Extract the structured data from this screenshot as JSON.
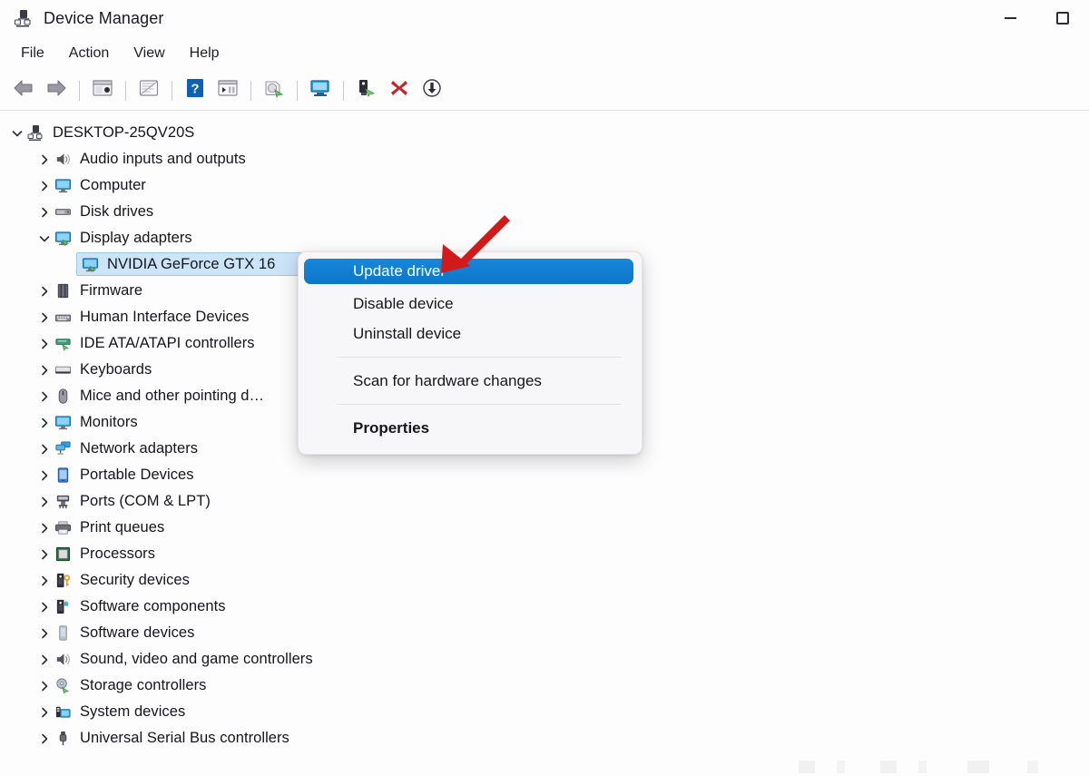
{
  "window": {
    "title": "Device Manager",
    "title_icon": "device-manager-icon",
    "minimize_label": "–",
    "maximize_label": "□"
  },
  "menubar": {
    "items": [
      {
        "label": "File"
      },
      {
        "label": "Action"
      },
      {
        "label": "View"
      },
      {
        "label": "Help"
      }
    ]
  },
  "toolbar": {
    "buttons": [
      {
        "name": "back-button",
        "icon": "back-arrow-icon"
      },
      {
        "name": "forward-button",
        "icon": "forward-arrow-icon"
      },
      {
        "name": "show-hide-console-tree-button",
        "icon": "console-tree-icon"
      },
      {
        "name": "properties-button",
        "icon": "properties-window-icon"
      },
      {
        "name": "help-button",
        "icon": "help-question-icon"
      },
      {
        "name": "show-hide-action-pane-button",
        "icon": "action-pane-icon"
      },
      {
        "name": "update-driver-software-button",
        "icon": "update-driver-icon"
      },
      {
        "name": "scan-for-hardware-changes-button",
        "icon": "monitor-scan-icon"
      },
      {
        "name": "update-device-driver-button",
        "icon": "driver-update-icon"
      },
      {
        "name": "uninstall-device-button",
        "icon": "red-x-icon"
      },
      {
        "name": "disable-device-button",
        "icon": "down-arrow-circle-icon"
      }
    ]
  },
  "tree": {
    "root": {
      "label": "DESKTOP-25QV20S",
      "icon": "computer-root-icon",
      "expanded": true
    },
    "items": [
      {
        "label": "Audio inputs and outputs",
        "icon": "speaker-icon",
        "expanded": false,
        "level": 1
      },
      {
        "label": "Computer",
        "icon": "monitor-icon",
        "expanded": false,
        "level": 1
      },
      {
        "label": "Disk drives",
        "icon": "disk-drive-icon",
        "expanded": false,
        "level": 1
      },
      {
        "label": "Display adapters",
        "icon": "display-adapter-icon",
        "expanded": true,
        "level": 1
      },
      {
        "label": "NVIDIA GeForce GTX 16",
        "icon": "display-adapter-icon",
        "expanded": null,
        "level": 2,
        "selected": true
      },
      {
        "label": "Firmware",
        "icon": "firmware-icon",
        "expanded": false,
        "level": 1
      },
      {
        "label": "Human Interface Devices",
        "icon": "hid-icon",
        "expanded": false,
        "level": 1
      },
      {
        "label": "IDE ATA/ATAPI controllers",
        "icon": "ide-controller-icon",
        "expanded": false,
        "level": 1
      },
      {
        "label": "Keyboards",
        "icon": "keyboard-icon",
        "expanded": false,
        "level": 1
      },
      {
        "label": "Mice and other pointing d…",
        "icon": "mouse-icon",
        "expanded": false,
        "level": 1
      },
      {
        "label": "Monitors",
        "icon": "monitor-icon",
        "expanded": false,
        "level": 1
      },
      {
        "label": "Network adapters",
        "icon": "network-adapter-icon",
        "expanded": false,
        "level": 1
      },
      {
        "label": "Portable Devices",
        "icon": "portable-device-icon",
        "expanded": false,
        "level": 1
      },
      {
        "label": "Ports (COM & LPT)",
        "icon": "port-icon",
        "expanded": false,
        "level": 1
      },
      {
        "label": "Print queues",
        "icon": "printer-icon",
        "expanded": false,
        "level": 1
      },
      {
        "label": "Processors",
        "icon": "processor-icon",
        "expanded": false,
        "level": 1
      },
      {
        "label": "Security devices",
        "icon": "security-device-icon",
        "expanded": false,
        "level": 1
      },
      {
        "label": "Software components",
        "icon": "software-component-icon",
        "expanded": false,
        "level": 1
      },
      {
        "label": "Software devices",
        "icon": "software-device-icon",
        "expanded": false,
        "level": 1
      },
      {
        "label": "Sound, video and game controllers",
        "icon": "speaker-icon",
        "expanded": false,
        "level": 1
      },
      {
        "label": "Storage controllers",
        "icon": "storage-controller-icon",
        "expanded": false,
        "level": 1
      },
      {
        "label": "System devices",
        "icon": "system-device-icon",
        "expanded": false,
        "level": 1
      },
      {
        "label": "Universal Serial Bus controllers",
        "icon": "usb-icon",
        "expanded": false,
        "level": 1
      }
    ]
  },
  "context_menu": {
    "items": [
      {
        "label": "Update driver",
        "highlighted": true,
        "bold": false
      },
      {
        "label": "Disable device",
        "highlighted": false,
        "bold": false
      },
      {
        "label": "Uninstall device",
        "highlighted": false,
        "bold": false
      },
      {
        "label": "Scan for hardware changes",
        "highlighted": false,
        "bold": false
      },
      {
        "label": "Properties",
        "highlighted": false,
        "bold": true
      }
    ]
  },
  "annotation": {
    "arrow": "red-arrow-pointing-to-update-driver",
    "color": "#d31a1a"
  },
  "colors": {
    "highlight_blue": "#0f7fd4",
    "selection_blue": "#cce4f7",
    "window_background": "#fdfdfe",
    "menu_background": "#f7f7f9",
    "text": "#15151c",
    "annotation_red": "#d31a1a"
  }
}
